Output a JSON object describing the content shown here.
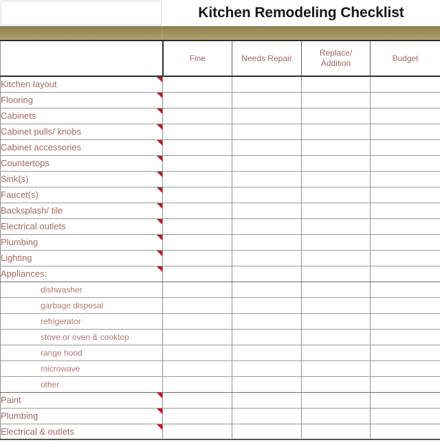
{
  "document": {
    "title": "Kitchen Remodeling Checklist",
    "accent_bar_color": "#a3925f",
    "label_text_color": "#a06a62",
    "title_text_color": "#171717",
    "comment_flag_color": "#c0162b"
  },
  "table": {
    "columns": [
      {
        "key": "item",
        "label": ""
      },
      {
        "key": "fine",
        "label": "Fine"
      },
      {
        "key": "needs_repair",
        "label": "Needs Repair"
      },
      {
        "key": "replace_addition",
        "label": "Replace/\nAddition"
      },
      {
        "key": "budget",
        "label": "Budget"
      }
    ],
    "column_labels_flat": [
      "",
      "Fine",
      "Needs Repair",
      "Replace/ Addition",
      "Budget"
    ],
    "replace_addition_line1": "Replace/",
    "replace_addition_line2": "Addition",
    "rows": [
      {
        "label": "Kitchen layout",
        "indent": false,
        "flag": true,
        "fine": "",
        "needs_repair": "",
        "replace_addition": "",
        "budget": ""
      },
      {
        "label": "Flooring",
        "indent": false,
        "flag": true,
        "fine": "",
        "needs_repair": "",
        "replace_addition": "",
        "budget": ""
      },
      {
        "label": "Cabinets",
        "indent": false,
        "flag": true,
        "fine": "",
        "needs_repair": "",
        "replace_addition": "",
        "budget": ""
      },
      {
        "label": "Cabinet pulls/ knobs",
        "indent": false,
        "flag": true,
        "fine": "",
        "needs_repair": "",
        "replace_addition": "",
        "budget": ""
      },
      {
        "label": "Cabinet accessories",
        "indent": false,
        "flag": true,
        "fine": "",
        "needs_repair": "",
        "replace_addition": "",
        "budget": ""
      },
      {
        "label": "Countertops",
        "indent": false,
        "flag": true,
        "fine": "",
        "needs_repair": "",
        "replace_addition": "",
        "budget": ""
      },
      {
        "label": "Sink(s)",
        "indent": false,
        "flag": true,
        "fine": "",
        "needs_repair": "",
        "replace_addition": "",
        "budget": ""
      },
      {
        "label": "Faucet(s)",
        "indent": false,
        "flag": true,
        "fine": "",
        "needs_repair": "",
        "replace_addition": "",
        "budget": ""
      },
      {
        "label": "Backsplash/ tile",
        "indent": false,
        "flag": true,
        "fine": "",
        "needs_repair": "",
        "replace_addition": "",
        "budget": ""
      },
      {
        "label": "Electrical outlets",
        "indent": false,
        "flag": true,
        "fine": "",
        "needs_repair": "",
        "replace_addition": "",
        "budget": ""
      },
      {
        "label": "Plumbing",
        "indent": false,
        "flag": true,
        "fine": "",
        "needs_repair": "",
        "replace_addition": "",
        "budget": ""
      },
      {
        "label": "Lighting",
        "indent": false,
        "flag": true,
        "fine": "",
        "needs_repair": "",
        "replace_addition": "",
        "budget": ""
      },
      {
        "label": "Appliances:",
        "indent": false,
        "flag": true,
        "fine": "",
        "needs_repair": "",
        "replace_addition": "",
        "budget": ""
      },
      {
        "label": "dishwasher",
        "indent": true,
        "flag": false,
        "fine": "",
        "needs_repair": "",
        "replace_addition": "",
        "budget": ""
      },
      {
        "label": "garbage disposal",
        "indent": true,
        "flag": false,
        "fine": "",
        "needs_repair": "",
        "replace_addition": "",
        "budget": ""
      },
      {
        "label": "refrigerator",
        "indent": true,
        "flag": false,
        "fine": "",
        "needs_repair": "",
        "replace_addition": "",
        "budget": ""
      },
      {
        "label": "stove or oven & cooktop",
        "indent": true,
        "flag": false,
        "fine": "",
        "needs_repair": "",
        "replace_addition": "",
        "budget": ""
      },
      {
        "label": "range hood",
        "indent": true,
        "flag": false,
        "fine": "",
        "needs_repair": "",
        "replace_addition": "",
        "budget": ""
      },
      {
        "label": "microwave",
        "indent": true,
        "flag": false,
        "fine": "",
        "needs_repair": "",
        "replace_addition": "",
        "budget": ""
      },
      {
        "label": "other",
        "indent": true,
        "flag": false,
        "fine": "",
        "needs_repair": "",
        "replace_addition": "",
        "budget": ""
      },
      {
        "label": "Paint",
        "indent": false,
        "flag": true,
        "fine": "",
        "needs_repair": "",
        "replace_addition": "",
        "budget": ""
      },
      {
        "label": "Plumbing",
        "indent": false,
        "flag": true,
        "fine": "",
        "needs_repair": "",
        "replace_addition": "",
        "budget": ""
      },
      {
        "label": "Electrical & outlets",
        "indent": false,
        "flag": true,
        "fine": "",
        "needs_repair": "",
        "replace_addition": "",
        "budget": ""
      }
    ]
  }
}
